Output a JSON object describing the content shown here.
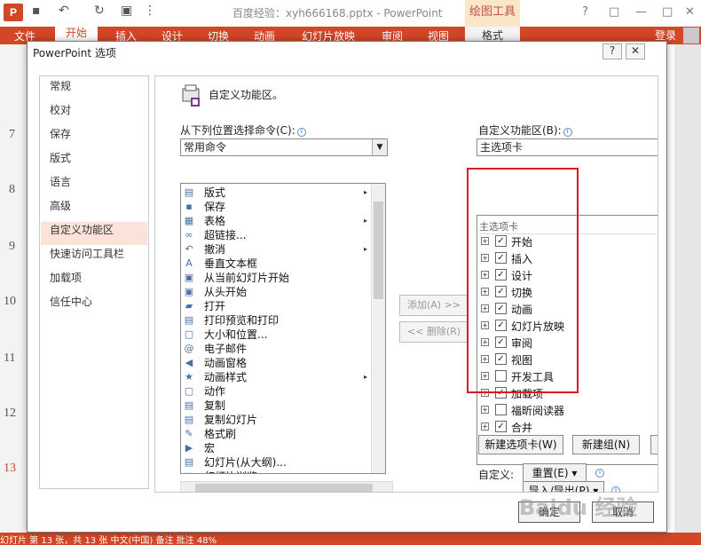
{
  "app": {
    "logo_text": "P",
    "doc_title": "百度经验：xyh666168.pptx - PowerPoint",
    "context_tab": "绘图工具",
    "win_help": "?",
    "win_min": "—",
    "win_max": "□",
    "win_close": "✕",
    "login": "登录",
    "tabs": [
      "文件",
      "开始",
      "插入",
      "设计",
      "切换",
      "动画",
      "幻灯片放映",
      "审阅",
      "视图",
      "格式"
    ],
    "slide_numbers": [
      "7",
      "8",
      "9",
      "10",
      "11",
      "12",
      "13"
    ],
    "status_text": "幻灯片 第 13 张，共 13 张        中文(中国)        备注        批注              48%"
  },
  "dialog": {
    "title": "PowerPoint 选项",
    "help_btn": "?",
    "close_btn": "✕",
    "nav": [
      "常规",
      "校对",
      "保存",
      "版式",
      "语言",
      "高级",
      "自定义功能区",
      "快速访问工具栏",
      "加载项",
      "信任中心"
    ],
    "selected_nav": "自定义功能区",
    "header": "自定义功能区。",
    "choose_label": "从下列位置选择命令(C):",
    "choose_value": "常用命令",
    "customize_label": "自定义功能区(B):",
    "customize_value": "主选项卡",
    "commands": [
      {
        "label": "版式",
        "icon": "▤",
        "sub": "▸"
      },
      {
        "label": "保存",
        "icon": "▪",
        "sub": ""
      },
      {
        "label": "表格",
        "icon": "▦",
        "sub": "▸"
      },
      {
        "label": "超链接...",
        "icon": "∞",
        "sub": ""
      },
      {
        "label": "撤消",
        "icon": "↶",
        "sub": "▸"
      },
      {
        "label": "垂直文本框",
        "icon": "A",
        "sub": ""
      },
      {
        "label": "从当前幻灯片开始",
        "icon": "▣",
        "sub": ""
      },
      {
        "label": "从头开始",
        "icon": "▣",
        "sub": ""
      },
      {
        "label": "打开",
        "icon": "▰",
        "sub": ""
      },
      {
        "label": "打印预览和打印",
        "icon": "▤",
        "sub": ""
      },
      {
        "label": "大小和位置...",
        "icon": "▢",
        "sub": ""
      },
      {
        "label": "电子邮件",
        "icon": "@",
        "sub": ""
      },
      {
        "label": "动画窗格",
        "icon": "◀",
        "sub": ""
      },
      {
        "label": "动画样式",
        "icon": "★",
        "sub": "▸"
      },
      {
        "label": "动作",
        "icon": "▢",
        "sub": ""
      },
      {
        "label": "复制",
        "icon": "▤",
        "sub": ""
      },
      {
        "label": "复制幻灯片",
        "icon": "▤",
        "sub": ""
      },
      {
        "label": "格式刷",
        "icon": "✎",
        "sub": ""
      },
      {
        "label": "宏",
        "icon": "▶",
        "sub": ""
      },
      {
        "label": "幻灯片(从大纲)...",
        "icon": "▤",
        "sub": ""
      },
      {
        "label": "幻灯片浏览",
        "icon": "▦",
        "sub": ""
      }
    ],
    "add_btn": "添加(A) >>",
    "remove_btn": "<< 删除(R)",
    "tree_header": "主选项卡",
    "tabs_tree": [
      {
        "label": "开始",
        "checked": true
      },
      {
        "label": "插入",
        "checked": true
      },
      {
        "label": "设计",
        "checked": true
      },
      {
        "label": "切换",
        "checked": true
      },
      {
        "label": "动画",
        "checked": true
      },
      {
        "label": "幻灯片放映",
        "checked": true
      },
      {
        "label": "审阅",
        "checked": true
      },
      {
        "label": "视图",
        "checked": true
      },
      {
        "label": "开发工具",
        "checked": false
      },
      {
        "label": "加载项",
        "checked": true
      },
      {
        "label": "福昕阅读器",
        "checked": false
      },
      {
        "label": "合并",
        "checked": true
      }
    ],
    "new_tab_btn": "新建选项卡(W)",
    "new_group_btn": "新建组(N)",
    "customize_prefix": "自定义:",
    "reset_btn": "重置(E) ▾",
    "import_export_btn": "导入/导出(P) ▾",
    "ok_btn": "确定",
    "cancel_btn": "取消"
  },
  "watermark": "Baidu 经验"
}
